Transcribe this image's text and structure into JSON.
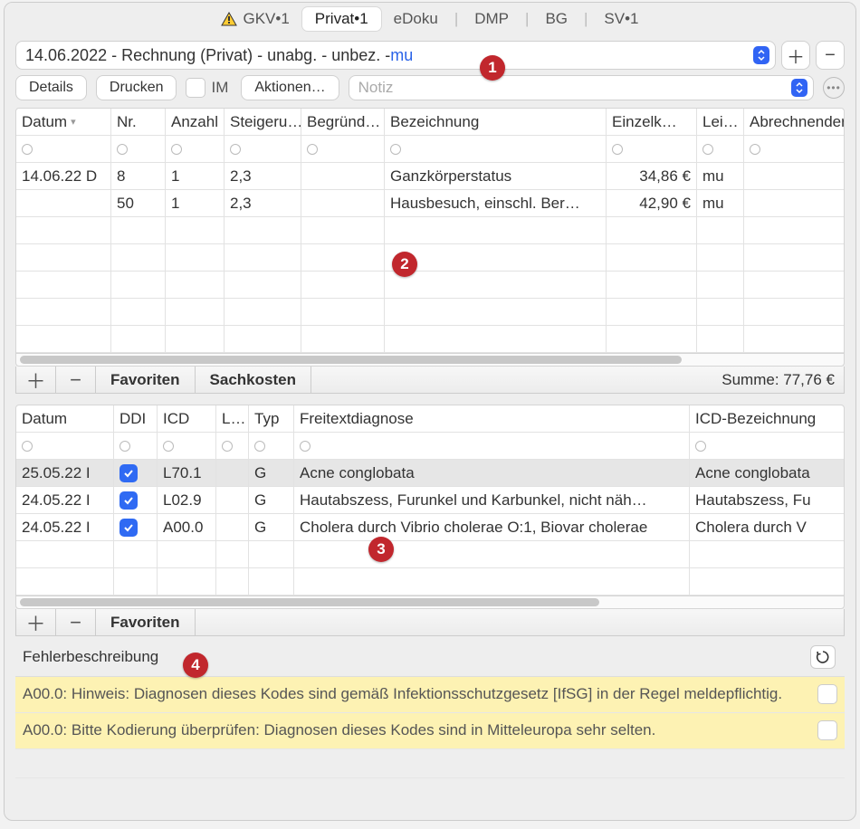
{
  "top_tabs": [
    {
      "label": "GKV•1",
      "warn": true
    },
    {
      "label": "Privat•1",
      "active": true
    },
    {
      "label": "eDoku"
    },
    {
      "label": "DMP"
    },
    {
      "label": "BG"
    },
    {
      "label": "SV•1"
    }
  ],
  "invoice_selector": {
    "text": "14.06.2022 - Rechnung (Privat) - unabg. - unbez. - ",
    "suffix": "mu"
  },
  "toolbar": {
    "details": "Details",
    "drucken": "Drucken",
    "im": "IM",
    "aktionen": "Aktionen…",
    "notiz_placeholder": "Notiz"
  },
  "table1": {
    "sum_label": "Summe: 77,76 €",
    "columns": [
      "Datum",
      "Nr.",
      "Anzahl",
      "Steigeru…",
      "Begründ…",
      "Bezeichnung",
      "Einzelk…",
      "Lei…",
      "Abrechnender /"
    ],
    "rows": [
      {
        "datum": "14.06.22  D",
        "nr": "8",
        "anz": "1",
        "stg": "2,3",
        "beg": "",
        "bez": "Ganzkörperstatus",
        "ek": "34,86 €",
        "lei": "mu",
        "abr": ""
      },
      {
        "datum": "",
        "nr": "50",
        "anz": "1",
        "stg": "2,3",
        "beg": "",
        "bez": "Hausbesuch, einschl. Ber…",
        "ek": "42,90 €",
        "lei": "mu",
        "abr": ""
      }
    ]
  },
  "subtoolbar1": {
    "favoriten": "Favoriten",
    "sachkosten": "Sachkosten"
  },
  "table2": {
    "columns": [
      "Datum",
      "DDI",
      "ICD",
      "L…",
      "Typ",
      "Freitextdiagnose",
      "ICD-Bezeichnung"
    ],
    "rows": [
      {
        "datum": "25.05.22  I",
        "ddi": true,
        "icd": "L70.1",
        "l": "",
        "typ": "G",
        "ft": "Acne conglobata",
        "icdbez": "Acne conglobata",
        "sel": true
      },
      {
        "datum": "24.05.22  I",
        "ddi": true,
        "icd": "L02.9",
        "l": "",
        "typ": "G",
        "ft": "Hautabszess, Furunkel und Karbunkel, nicht näh…",
        "icdbez": "Hautabszess, Fu"
      },
      {
        "datum": "24.05.22  I",
        "ddi": true,
        "icd": "A00.0",
        "l": "",
        "typ": "G",
        "ft": "Cholera durch Vibrio cholerae O:1, Biovar cholerae",
        "icdbez": "Cholera durch V"
      }
    ]
  },
  "subtoolbar2": {
    "favoriten": "Favoriten"
  },
  "errors": {
    "header": "Fehlerbeschreibung",
    "rows": [
      {
        "text": "A00.0: Hinweis: Diagnosen dieses Kodes sind gemäß Infektionsschutzgesetz [IfSG] in der Regel meldepflichtig.",
        "warn": true
      },
      {
        "text": "A00.0: Bitte Kodierung überprüfen: Diagnosen dieses Kodes sind in Mitteleuropa sehr selten.",
        "warn": true
      },
      {
        "text": "",
        "warn": false
      }
    ]
  },
  "badges": {
    "b1": "1",
    "b2": "2",
    "b3": "3",
    "b4": "4"
  }
}
